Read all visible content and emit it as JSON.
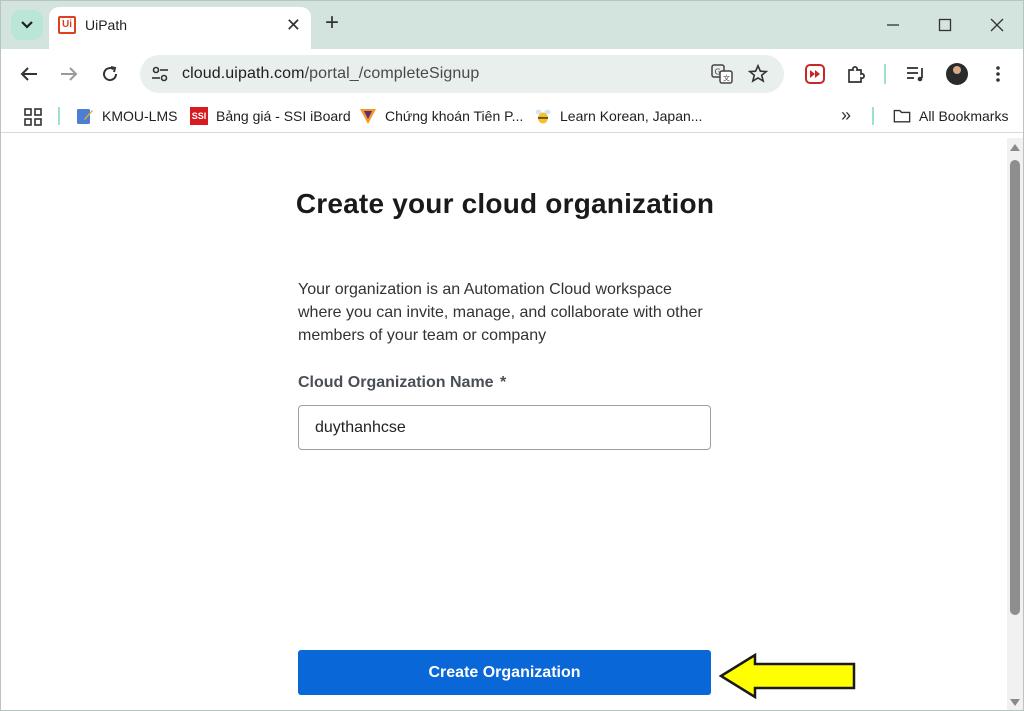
{
  "browser": {
    "tab": {
      "title": "UiPath",
      "favicon_text": "Ui"
    },
    "address_bar": {
      "host": "cloud.uipath.com",
      "path": "/portal_/completeSignup"
    },
    "bookmarks": [
      {
        "label": "KMOU-LMS",
        "icon": "kmou-icon"
      },
      {
        "label": "Bảng giá - SSI iBoard",
        "icon": "ssi-icon",
        "icon_text": "SSI"
      },
      {
        "label": "Chứng khoán Tiên P...",
        "icon": "tpbs-icon"
      },
      {
        "label": "Learn Korean, Japan...",
        "icon": "bee-icon"
      }
    ],
    "all_bookmarks_label": "All Bookmarks",
    "more_bookmarks_glyph": "»"
  },
  "page": {
    "heading": "Create your cloud organization",
    "description": "Your organization is an Automation Cloud workspace where you can invite, manage, and collaborate with other members of your team or company",
    "org_field": {
      "label": "Cloud Organization Name",
      "required_marker": "*",
      "value": "duythanhcse"
    },
    "submit_label": "Create Organization"
  },
  "colors": {
    "accent": "#0a67d8",
    "tabstrip": "#d3e3dd",
    "annotation_arrow": "#ffff00"
  }
}
